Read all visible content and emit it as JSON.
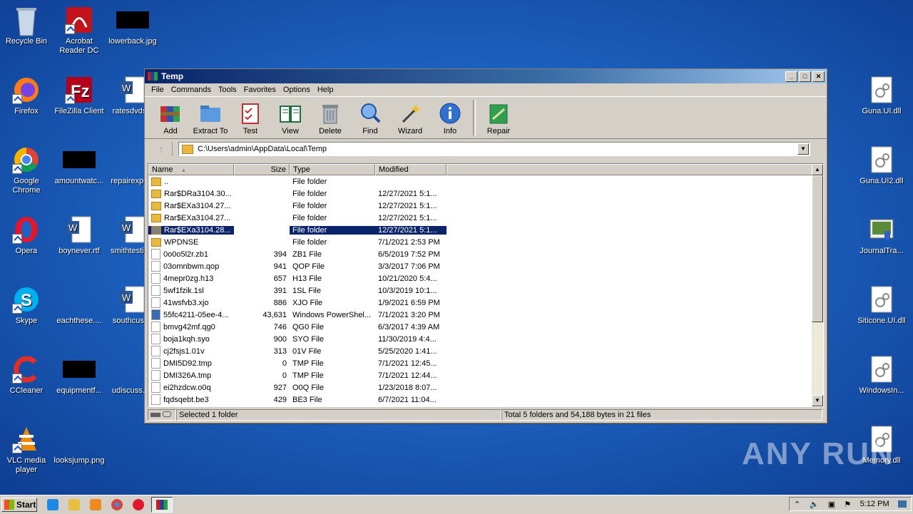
{
  "desktop": {
    "icons_left": [
      {
        "label": "Recycle Bin"
      },
      {
        "label": "Acrobat Reader DC"
      },
      {
        "label": "lowerback.jpg"
      },
      {
        "label": "Firefox"
      },
      {
        "label": "FileZilla Client"
      },
      {
        "label": "ratesdvds..."
      },
      {
        "label": "Google Chrome"
      },
      {
        "label": "amountwatc..."
      },
      {
        "label": "repairexpe..."
      },
      {
        "label": "Opera"
      },
      {
        "label": "boynever.rtf"
      },
      {
        "label": "smithtestin..."
      },
      {
        "label": "Skype"
      },
      {
        "label": "eachthese...."
      },
      {
        "label": "southcust..."
      },
      {
        "label": "CCleaner"
      },
      {
        "label": "equipmentf..."
      },
      {
        "label": "udiscuss.r..."
      },
      {
        "label": "VLC media player"
      },
      {
        "label": "looksjump.png"
      }
    ],
    "icons_right": [
      {
        "label": "Guna.UI.dll"
      },
      {
        "label": "Guna.UI2.dll"
      },
      {
        "label": "JournalTra..."
      },
      {
        "label": "Siticone.UI.dll"
      },
      {
        "label": "WindowsIn..."
      },
      {
        "label": "Memory.dll"
      }
    ],
    "watermark": "ANY RUN"
  },
  "window": {
    "title": "Temp",
    "menu": [
      "File",
      "Commands",
      "Tools",
      "Favorites",
      "Options",
      "Help"
    ],
    "toolbar": [
      {
        "label": "Add",
        "icon": "add-icon"
      },
      {
        "label": "Extract To",
        "icon": "extract-icon"
      },
      {
        "label": "Test",
        "icon": "test-icon"
      },
      {
        "label": "View",
        "icon": "view-icon"
      },
      {
        "label": "Delete",
        "icon": "delete-icon"
      },
      {
        "label": "Find",
        "icon": "find-icon"
      },
      {
        "label": "Wizard",
        "icon": "wizard-icon"
      },
      {
        "label": "Info",
        "icon": "info-icon"
      },
      {
        "label": "Repair",
        "icon": "repair-icon"
      }
    ],
    "address": "C:\\Users\\admin\\AppData\\Local\\Temp",
    "columns": [
      "Name",
      "Size",
      "Type",
      "Modified"
    ],
    "files": [
      {
        "name": "..",
        "size": "",
        "type": "File folder",
        "modified": "",
        "kind": "folder"
      },
      {
        "name": "Rar$DRa3104.30...",
        "size": "",
        "type": "File folder",
        "modified": "12/27/2021 5:1...",
        "kind": "folder"
      },
      {
        "name": "Rar$EXa3104.27...",
        "size": "",
        "type": "File folder",
        "modified": "12/27/2021 5:1...",
        "kind": "folder"
      },
      {
        "name": "Rar$EXa3104.27...",
        "size": "",
        "type": "File folder",
        "modified": "12/27/2021 5:1...",
        "kind": "folder"
      },
      {
        "name": "Rar$EXa3104.28...",
        "size": "",
        "type": "File folder",
        "modified": "12/27/2021 5:1...",
        "kind": "folder",
        "selected": true
      },
      {
        "name": "WPDNSE",
        "size": "",
        "type": "File folder",
        "modified": "7/1/2021 2:53 PM",
        "kind": "folder"
      },
      {
        "name": "0o0o5l2r.zb1",
        "size": "394",
        "type": "ZB1 File",
        "modified": "6/5/2019 7:52 PM",
        "kind": "file"
      },
      {
        "name": "03omnbwm.qop",
        "size": "941",
        "type": "QOP File",
        "modified": "3/3/2017 7:06 PM",
        "kind": "file"
      },
      {
        "name": "4mepr0zg.h13",
        "size": "657",
        "type": "H13 File",
        "modified": "10/21/2020 5:4...",
        "kind": "file"
      },
      {
        "name": "5wf1fzik.1sl",
        "size": "391",
        "type": "1SL File",
        "modified": "10/3/2019 10:1...",
        "kind": "file"
      },
      {
        "name": "41wsfvb3.xjo",
        "size": "886",
        "type": "XJO File",
        "modified": "1/9/2021 6:59 PM",
        "kind": "file"
      },
      {
        "name": "55fc4211-05ee-4...",
        "size": "43,631",
        "type": "Windows PowerShel...",
        "modified": "7/1/2021 3:20 PM",
        "kind": "ps"
      },
      {
        "name": "bmvg42mf.qg0",
        "size": "746",
        "type": "QG0 File",
        "modified": "6/3/2017 4:39 AM",
        "kind": "file"
      },
      {
        "name": "boja1kqh.syo",
        "size": "900",
        "type": "SYO File",
        "modified": "11/30/2019 4:4...",
        "kind": "file"
      },
      {
        "name": "cj2fsjs1.01v",
        "size": "313",
        "type": "01V File",
        "modified": "5/25/2020 1:41...",
        "kind": "file"
      },
      {
        "name": "DMI5D92.tmp",
        "size": "0",
        "type": "TMP File",
        "modified": "7/1/2021 12:45...",
        "kind": "file"
      },
      {
        "name": "DMI326A.tmp",
        "size": "0",
        "type": "TMP File",
        "modified": "7/1/2021 12:44...",
        "kind": "file"
      },
      {
        "name": "ei2hzdcw.o0q",
        "size": "927",
        "type": "O0Q File",
        "modified": "1/23/2018 8:07...",
        "kind": "file"
      },
      {
        "name": "fqdsqebt.be3",
        "size": "429",
        "type": "BE3 File",
        "modified": "6/7/2021 11:04...",
        "kind": "file"
      }
    ],
    "status_left": "Selected 1 folder",
    "status_right": "Total 5 folders and 54,188 bytes in 21 files"
  },
  "taskbar": {
    "start": "Start",
    "clock": "5:12 PM"
  }
}
